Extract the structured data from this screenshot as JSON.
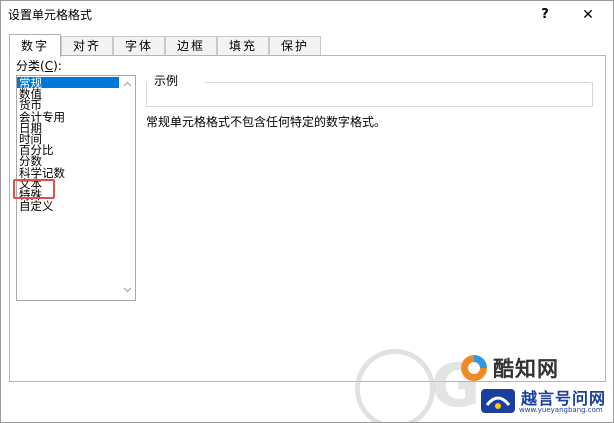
{
  "window": {
    "title": "设置单元格格式",
    "help_glyph": "?",
    "close_glyph": "✕"
  },
  "tabs": [
    {
      "label": "数字",
      "active": true
    },
    {
      "label": "对齐",
      "active": false
    },
    {
      "label": "字体",
      "active": false
    },
    {
      "label": "边框",
      "active": false
    },
    {
      "label": "填充",
      "active": false
    },
    {
      "label": "保护",
      "active": false
    }
  ],
  "category": {
    "label_prefix": "分类(",
    "label_accel": "C",
    "label_suffix": "):",
    "items": [
      "常规",
      "数值",
      "货币",
      "会计专用",
      "日期",
      "时间",
      "百分比",
      "分数",
      "科学记数",
      "文本",
      "特殊",
      "自定义"
    ],
    "selected_index": 0,
    "highlighted_index": 9,
    "highlight_color": "#e0504e",
    "selection_color": "#0078d7"
  },
  "sample": {
    "label": "示例"
  },
  "description": "常规单元格格式不包含任何特定的数字格式。",
  "watermark": {
    "brand1": "酷知网",
    "brand2": "越言号问网",
    "url": "www.yueyangbang.com"
  },
  "icons": {
    "help": "help-icon",
    "close": "close-icon",
    "scroll_up": "chevron-up-icon",
    "scroll_down": "chevron-down-icon"
  }
}
